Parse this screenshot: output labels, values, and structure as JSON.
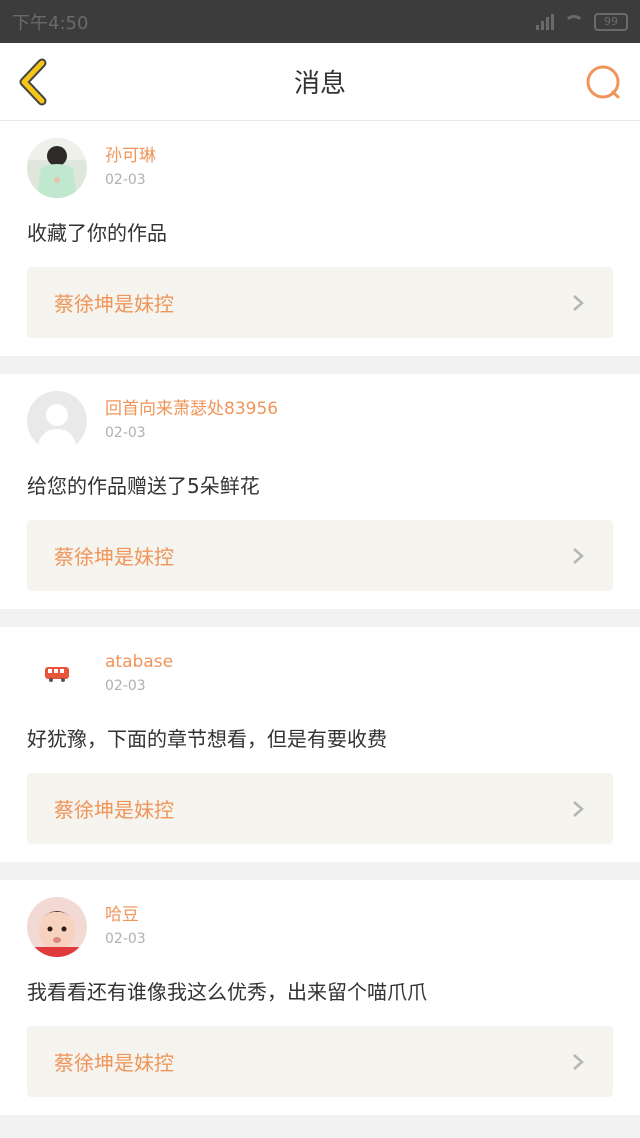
{
  "status_bar": {
    "time": "下午4:50",
    "battery": "99"
  },
  "header": {
    "title": "消息"
  },
  "messages": [
    {
      "user": "孙可琳",
      "date": "02-03",
      "text": "收藏了你的作品",
      "work_title": "蔡徐坤是妹控",
      "avatar": "girl-photo-avatar"
    },
    {
      "user": "回首向来萧瑟处83956",
      "date": "02-03",
      "text": "给您的作品赠送了5朵鲜花",
      "work_title": "蔡徐坤是妹控",
      "avatar": "default-avatar"
    },
    {
      "user": "atabase",
      "date": "02-03",
      "text": "好犹豫，下面的章节想看，但是有要收费",
      "work_title": "蔡徐坤是妹控",
      "avatar": "bus-avatar"
    },
    {
      "user": "哈豆",
      "date": "02-03",
      "text": "我看看还有谁像我这么优秀，出来留个喵爪爪",
      "work_title": "蔡徐坤是妹控",
      "avatar": "baby-photo-avatar"
    }
  ],
  "colors": {
    "accent": "#f0955a",
    "back_icon": "#f5c518",
    "card_link_bg": "#f5f4ef"
  }
}
